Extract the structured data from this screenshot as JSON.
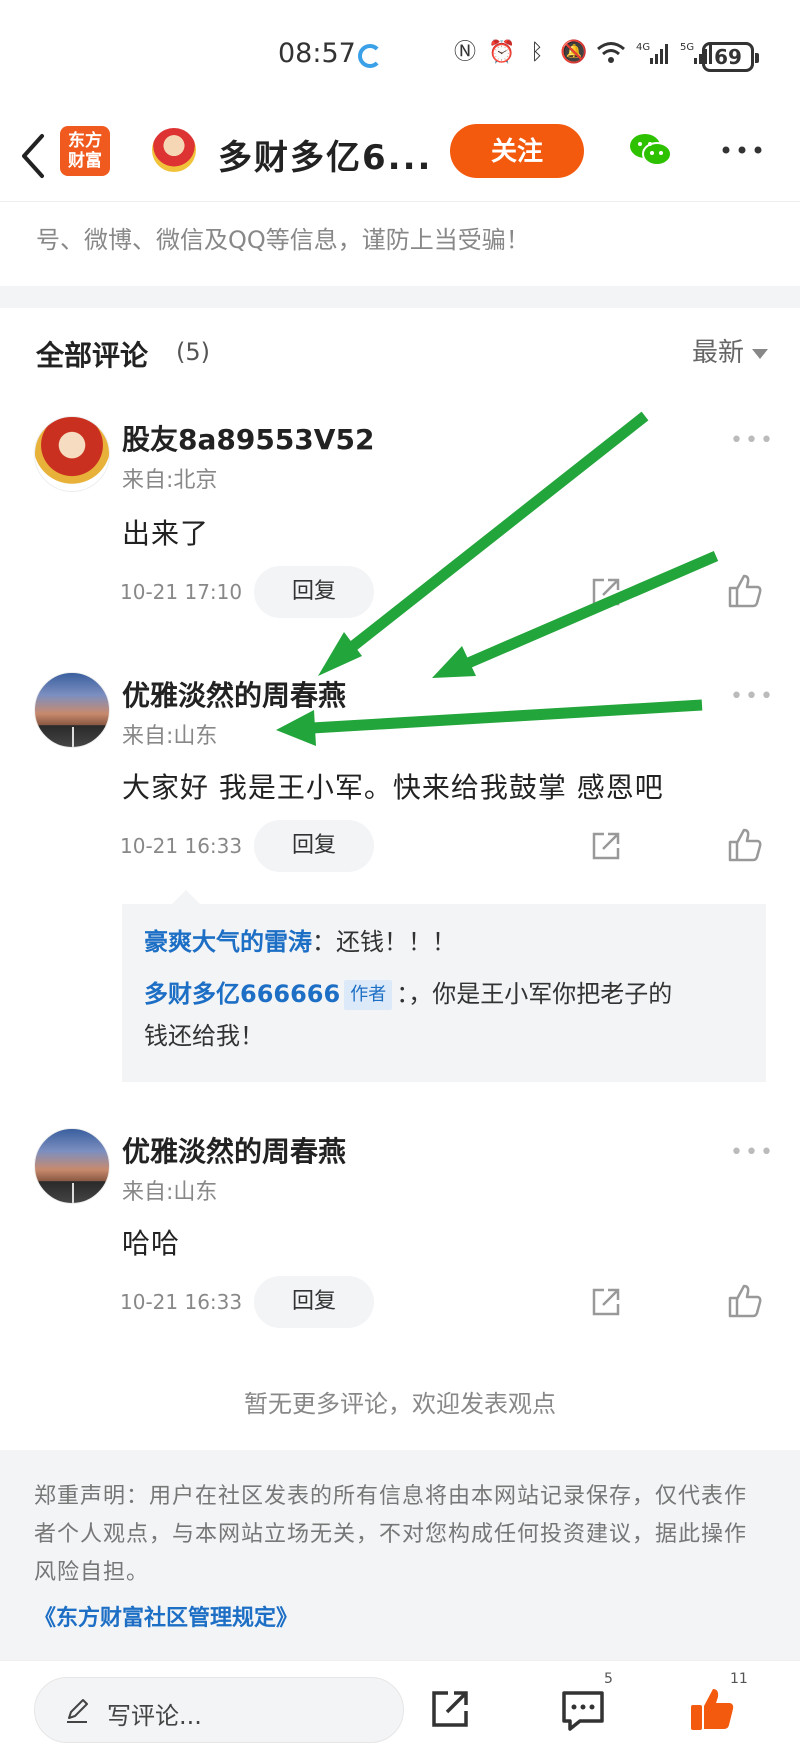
{
  "status_bar": {
    "time": "08:57",
    "battery": "69",
    "icons": [
      "nfc-icon",
      "alarm-icon",
      "bluetooth-icon",
      "mute-icon",
      "wifi-icon",
      "signal-4g-icon",
      "signal-5g-icon"
    ]
  },
  "header": {
    "logo_text": "东方\n财富",
    "title": "多财多亿6...",
    "follow_label": "关注"
  },
  "notice": {
    "text": "号、微博、微信及QQ等信息，谨防上当受骗！"
  },
  "comments_section": {
    "title": "全部评论",
    "count": "(5)",
    "sort_label": "最新"
  },
  "comments": [
    {
      "name": "股友8a89553V52",
      "from": "来自:北京",
      "body": "出来了",
      "time": "10-21 17:10",
      "reply_label": "回复",
      "avatar": "caishen-avatar"
    },
    {
      "name": "优雅淡然的周春燕",
      "from": "来自:山东",
      "body": "大家好 我是王小军。快来给我鼓掌 感恩吧",
      "time": "10-21 16:33",
      "reply_label": "回复",
      "avatar": "road-avatar"
    },
    {
      "name": "优雅淡然的周春燕",
      "from": "来自:山东",
      "body": "哈哈",
      "time": "10-21 16:33",
      "reply_label": "回复",
      "avatar": "road-avatar"
    }
  ],
  "replies": [
    {
      "name": "豪爽大气的雷涛",
      "text": "：还钱！！！"
    },
    {
      "name": "多财多亿666666",
      "tag": "作者",
      "text": "：，你是王小军你把老子的",
      "text2": "钱还给我！"
    }
  ],
  "no_more_text": "暂无更多评论，欢迎发表观点",
  "disclaimer": {
    "text": "郑重声明：用户在社区发表的所有信息将由本网站记录保存，仅代表作者个人观点，与本网站立场无关，不对您构成任何投资建议，据此操作风险自担。",
    "link": "《东方财富社区管理规定》"
  },
  "bottom_bar": {
    "input_placeholder": "写评论...",
    "comment_count": "5",
    "like_count": "11"
  },
  "colors": {
    "accent": "#f35a0e",
    "link": "#1d6fc5",
    "arrow": "#22a53a"
  }
}
